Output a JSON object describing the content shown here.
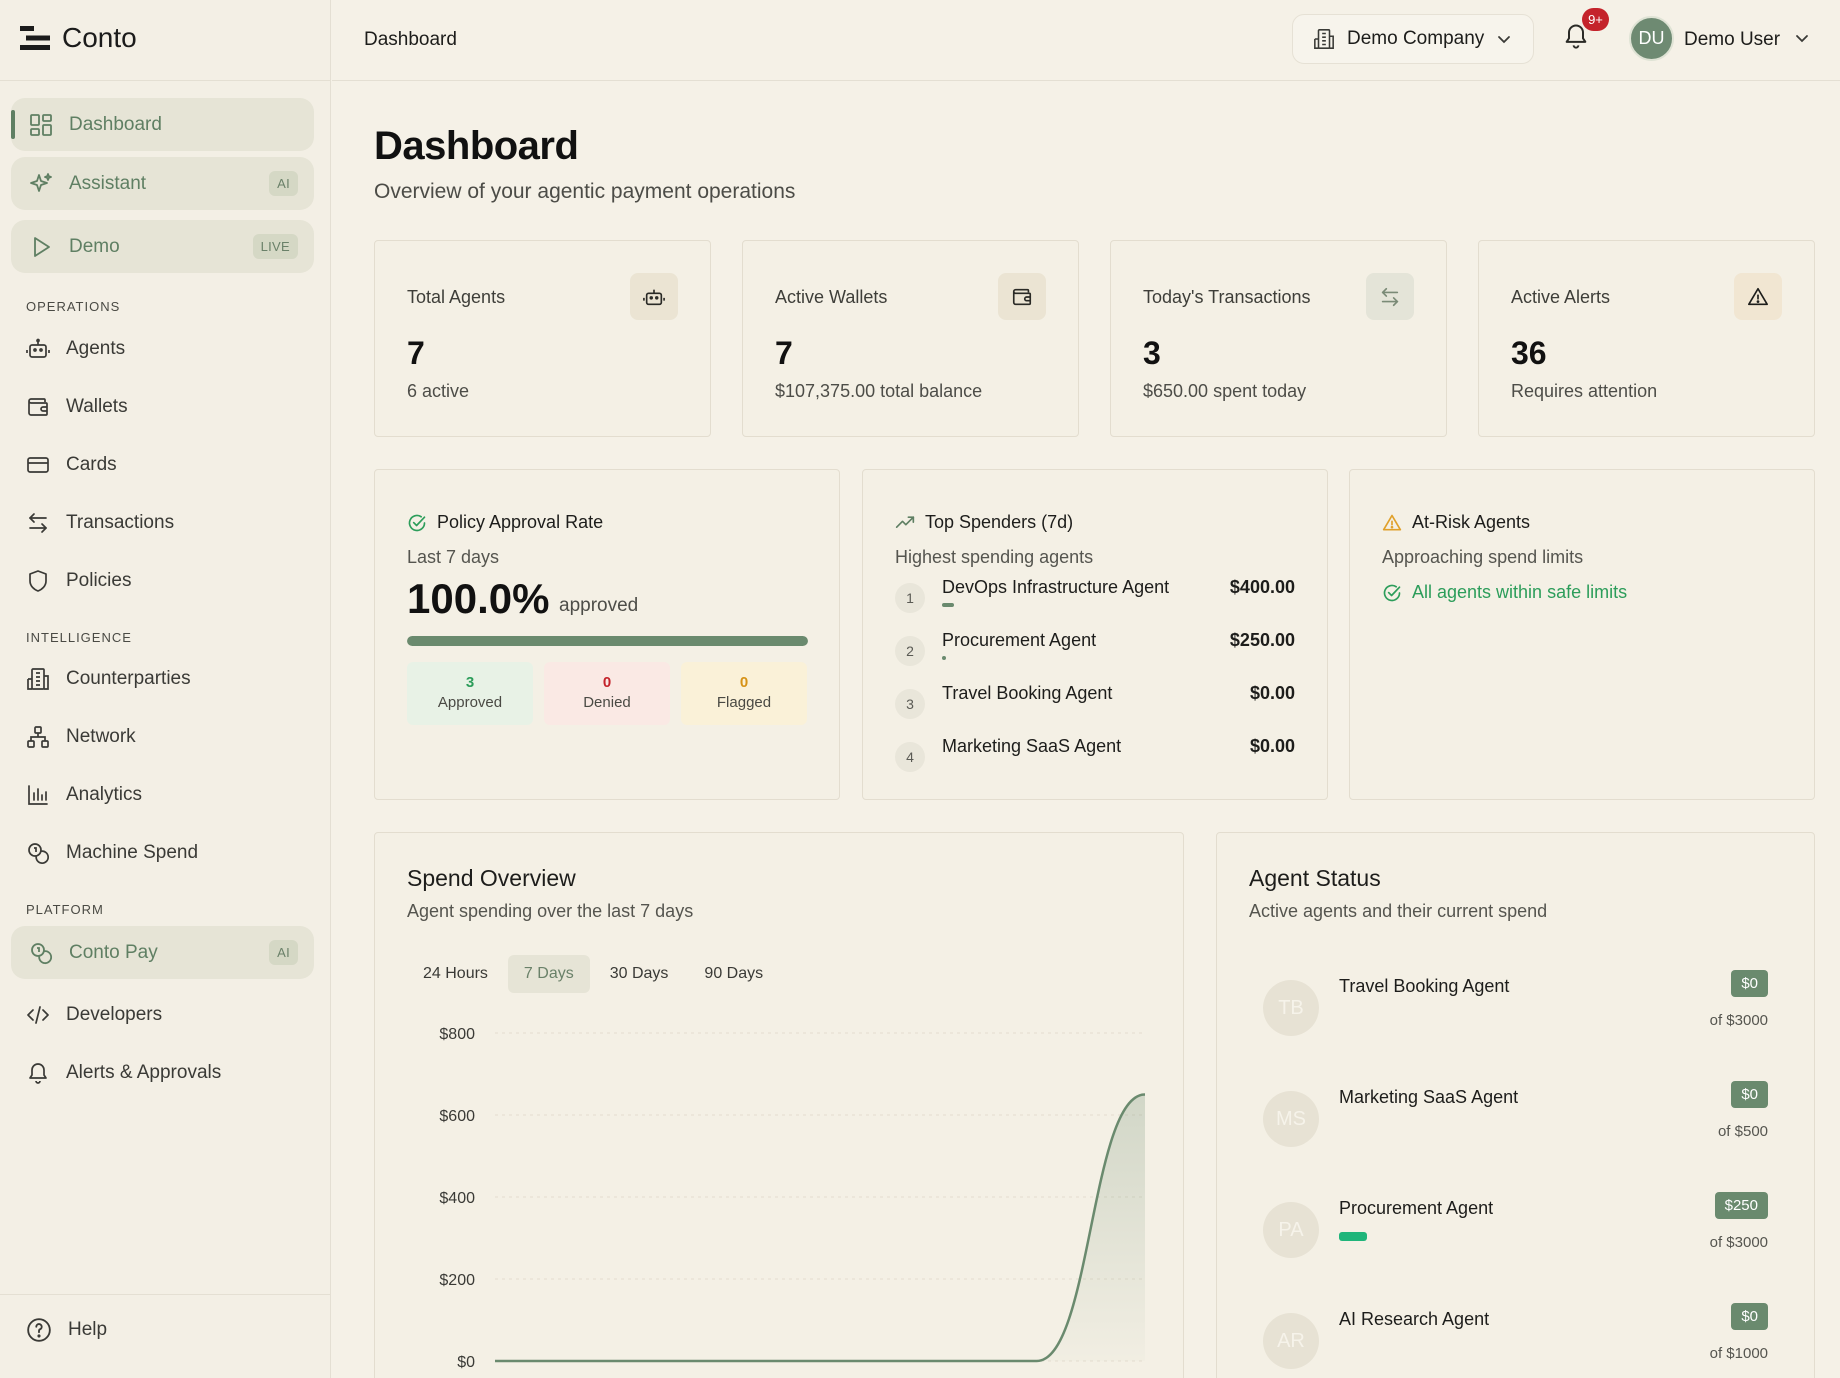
{
  "app": {
    "brand": "Conto"
  },
  "sidebar": {
    "pills": [
      {
        "label": "Dashboard",
        "badge": "",
        "icon": "grid-icon"
      },
      {
        "label": "Assistant",
        "badge": "AI",
        "icon": "sparkle-icon"
      },
      {
        "label": "Demo",
        "badge": "LIVE",
        "icon": "play-icon"
      }
    ],
    "sections": {
      "operations": "OPERATIONS",
      "intelligence": "INTELLIGENCE",
      "platform": "PLATFORM"
    },
    "operations": [
      "Agents",
      "Wallets",
      "Cards",
      "Transactions",
      "Policies"
    ],
    "intelligence": [
      "Counterparties",
      "Network",
      "Analytics",
      "Machine Spend"
    ],
    "platform_pill": {
      "label": "Conto Pay",
      "badge": "AI"
    },
    "platform": [
      "Developers",
      "Alerts & Approvals"
    ],
    "help": "Help"
  },
  "topbar": {
    "breadcrumb": "Dashboard",
    "company": "Demo Company",
    "notifications": "9+",
    "user_initials": "DU",
    "user_name": "Demo User"
  },
  "page": {
    "title": "Dashboard",
    "subtitle": "Overview of your agentic payment operations"
  },
  "stats": [
    {
      "label": "Total Agents",
      "value": "7",
      "sub": "6 active",
      "icon": "robot-icon"
    },
    {
      "label": "Active Wallets",
      "value": "7",
      "sub": "$107,375.00 total balance",
      "icon": "wallet-icon"
    },
    {
      "label": "Today's Transactions",
      "value": "3",
      "sub": "$650.00 spent today",
      "icon": "arrows-swap-icon"
    },
    {
      "label": "Active Alerts",
      "value": "36",
      "sub": "Requires attention",
      "icon": "warning-icon"
    }
  ],
  "policy": {
    "title": "Policy Approval Rate",
    "sub": "Last 7 days",
    "rate": "100.0%",
    "rate_word": "approved",
    "rate_fraction": 1.0,
    "approved_n": "3",
    "approved_t": "Approved",
    "denied_n": "0",
    "denied_t": "Denied",
    "flagged_n": "0",
    "flagged_t": "Flagged"
  },
  "top_spenders": {
    "title": "Top Spenders (7d)",
    "sub": "Highest spending agents",
    "items": [
      {
        "rank": "1",
        "name": "DevOps Infrastructure Agent",
        "amount": "$400.00",
        "share": 0.035
      },
      {
        "rank": "2",
        "name": "Procurement Agent",
        "amount": "$250.00",
        "share": 0.01
      },
      {
        "rank": "3",
        "name": "Travel Booking Agent",
        "amount": "$0.00",
        "share": 0
      },
      {
        "rank": "4",
        "name": "Marketing SaaS Agent",
        "amount": "$0.00",
        "share": 0
      }
    ]
  },
  "at_risk": {
    "title": "At-Risk Agents",
    "sub": "Approaching spend limits",
    "message": "All agents within safe limits"
  },
  "spend_overview": {
    "title": "Spend Overview",
    "sub": "Agent spending over the last 7 days",
    "tabs": [
      "24 Hours",
      "7 Days",
      "30 Days",
      "90 Days"
    ],
    "active_tab": "7 Days"
  },
  "chart_data": {
    "type": "area",
    "ytick_labels": [
      "$800",
      "$600",
      "$400",
      "$200",
      "$0"
    ],
    "ylim": [
      0,
      800
    ],
    "yticks": [
      800,
      600,
      400,
      200,
      0
    ],
    "x": [
      0,
      1,
      2,
      3,
      4,
      5,
      6
    ],
    "values": [
      0,
      0,
      0,
      0,
      0,
      0,
      650
    ],
    "color": "#6a8a6e",
    "grid": true
  },
  "agent_status": {
    "title": "Agent Status",
    "sub": "Active agents and their current spend",
    "agents": [
      {
        "initials": "TB",
        "name": "Travel Booking Agent",
        "spend": "$0",
        "limit": "of $3000",
        "usage": 0
      },
      {
        "initials": "MS",
        "name": "Marketing SaaS Agent",
        "spend": "$0",
        "limit": "of $500",
        "usage": 0
      },
      {
        "initials": "PA",
        "name": "Procurement Agent",
        "spend": "$250",
        "limit": "of $3000",
        "usage": 0.083
      },
      {
        "initials": "AR",
        "name": "AI Research Agent",
        "spend": "$0",
        "limit": "of $1000",
        "usage": 0
      }
    ]
  },
  "colors": {
    "accent": "#6a8a6e",
    "background": "#f5f1e7",
    "approved_bg": "#e9f4ea",
    "denied_bg": "#fbe9e6",
    "flagged_bg": "#fbf3dc",
    "success": "#2c9d5a",
    "danger": "#c4232b",
    "warning": "#e0a02a",
    "usage_bar": "#1fb57a"
  }
}
